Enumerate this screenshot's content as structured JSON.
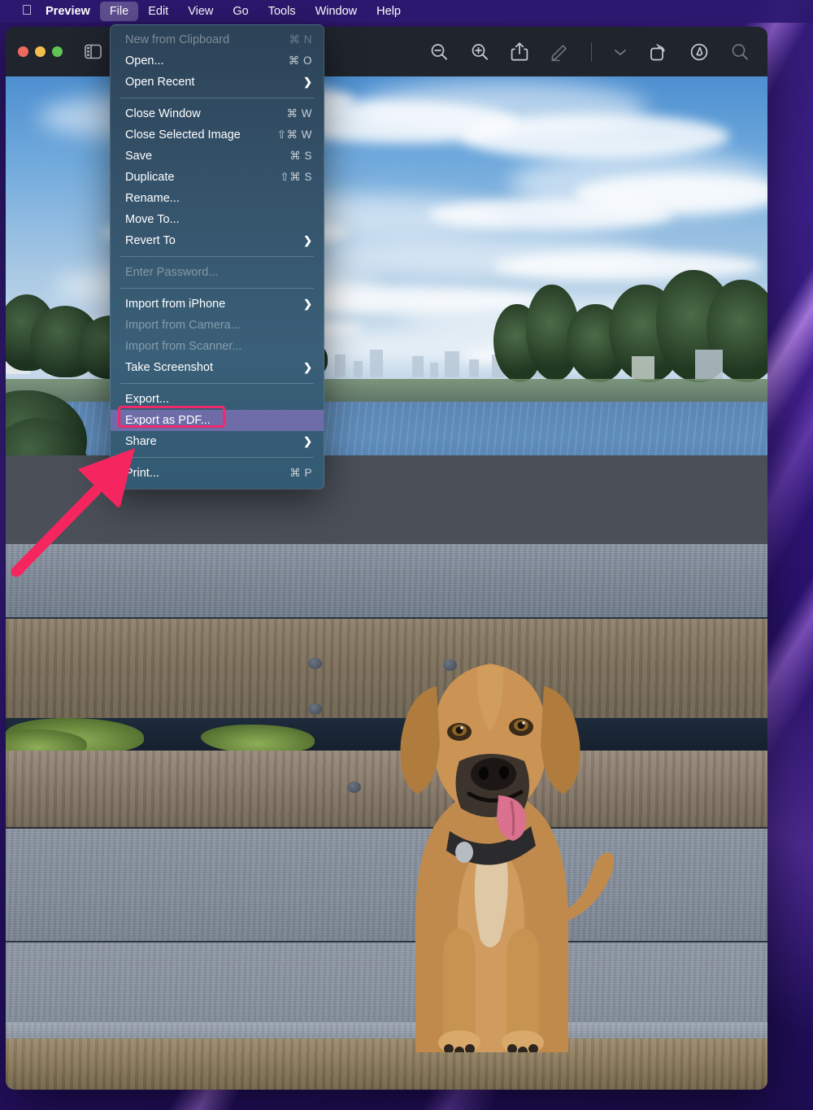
{
  "menubar": {
    "apple_icon": "apple-logo",
    "app_name": "Preview",
    "items": [
      {
        "label": "File",
        "active": true
      },
      {
        "label": "Edit",
        "active": false
      },
      {
        "label": "View",
        "active": false
      },
      {
        "label": "Go",
        "active": false
      },
      {
        "label": "Tools",
        "active": false
      },
      {
        "label": "Window",
        "active": false
      },
      {
        "label": "Help",
        "active": false
      }
    ]
  },
  "window": {
    "traffic_lights": [
      "close-red",
      "minimize-yellow",
      "zoom-green"
    ],
    "toolbar": {
      "sidebar_icon": "sidebar-toggle-icon",
      "buttons": [
        {
          "name": "zoom-out-icon"
        },
        {
          "name": "zoom-in-icon"
        },
        {
          "name": "share-icon"
        },
        {
          "name": "markup-pen-icon"
        },
        {
          "name": "chevron-down-icon"
        },
        {
          "name": "rotate-icon"
        },
        {
          "name": "annotate-icon"
        },
        {
          "name": "search-icon"
        }
      ]
    }
  },
  "file_menu": {
    "items": [
      {
        "label": "New from Clipboard",
        "shortcut": "⌘ N",
        "disabled": true,
        "submenu": false,
        "highlight": false
      },
      {
        "label": "Open...",
        "shortcut": "⌘ O",
        "disabled": false,
        "submenu": false,
        "highlight": false
      },
      {
        "label": "Open Recent",
        "shortcut": "",
        "disabled": false,
        "submenu": true,
        "highlight": false
      },
      {
        "separator": true
      },
      {
        "label": "Close Window",
        "shortcut": "⌘ W",
        "disabled": false,
        "submenu": false,
        "highlight": false
      },
      {
        "label": "Close Selected Image",
        "shortcut": "⇧⌘ W",
        "disabled": false,
        "submenu": false,
        "highlight": false
      },
      {
        "label": "Save",
        "shortcut": "⌘ S",
        "disabled": false,
        "submenu": false,
        "highlight": false
      },
      {
        "label": "Duplicate",
        "shortcut": "⇧⌘ S",
        "disabled": false,
        "submenu": false,
        "highlight": false
      },
      {
        "label": "Rename...",
        "shortcut": "",
        "disabled": false,
        "submenu": false,
        "highlight": false
      },
      {
        "label": "Move To...",
        "shortcut": "",
        "disabled": false,
        "submenu": false,
        "highlight": false
      },
      {
        "label": "Revert To",
        "shortcut": "",
        "disabled": false,
        "submenu": true,
        "highlight": false
      },
      {
        "separator": true
      },
      {
        "label": "Enter Password...",
        "shortcut": "",
        "disabled": true,
        "submenu": false,
        "highlight": false
      },
      {
        "separator": true
      },
      {
        "label": "Import from iPhone",
        "shortcut": "",
        "disabled": false,
        "submenu": true,
        "highlight": false
      },
      {
        "label": "Import from Camera...",
        "shortcut": "",
        "disabled": true,
        "submenu": false,
        "highlight": false
      },
      {
        "label": "Import from Scanner...",
        "shortcut": "",
        "disabled": true,
        "submenu": false,
        "highlight": false
      },
      {
        "label": "Take Screenshot",
        "shortcut": "",
        "disabled": false,
        "submenu": true,
        "highlight": false
      },
      {
        "separator": true
      },
      {
        "label": "Export...",
        "shortcut": "",
        "disabled": false,
        "submenu": false,
        "highlight": false
      },
      {
        "label": "Export as PDF...",
        "shortcut": "",
        "disabled": false,
        "submenu": false,
        "highlight": true
      },
      {
        "label": "Share",
        "shortcut": "",
        "disabled": false,
        "submenu": true,
        "highlight": false
      },
      {
        "separator": true
      },
      {
        "label": "Print...",
        "shortcut": "⌘ P",
        "disabled": false,
        "submenu": false,
        "highlight": false
      }
    ]
  },
  "annotations": {
    "highlight_box": {
      "name": "export-as-pdf-callout-box",
      "color": "#f0296b"
    },
    "arrow": {
      "name": "red-arrow-pointer",
      "color": "#f5265f",
      "points_to": "Export as PDF..."
    }
  },
  "photo": {
    "description": "Tan dog sitting on a grey wooden deck by a lake",
    "top_scene": "lake with blue sky, clouds, distant skyline and treed shoreline",
    "bottom_scene": "wooden deck boards with dog"
  },
  "colors": {
    "menubar_bg": "#2d186e",
    "titlebar_bg": "#20242c",
    "menu_bg": "#35546c",
    "highlight": "#9678cd",
    "accent_red": "#f0296b",
    "desktop": "#2a1566"
  }
}
